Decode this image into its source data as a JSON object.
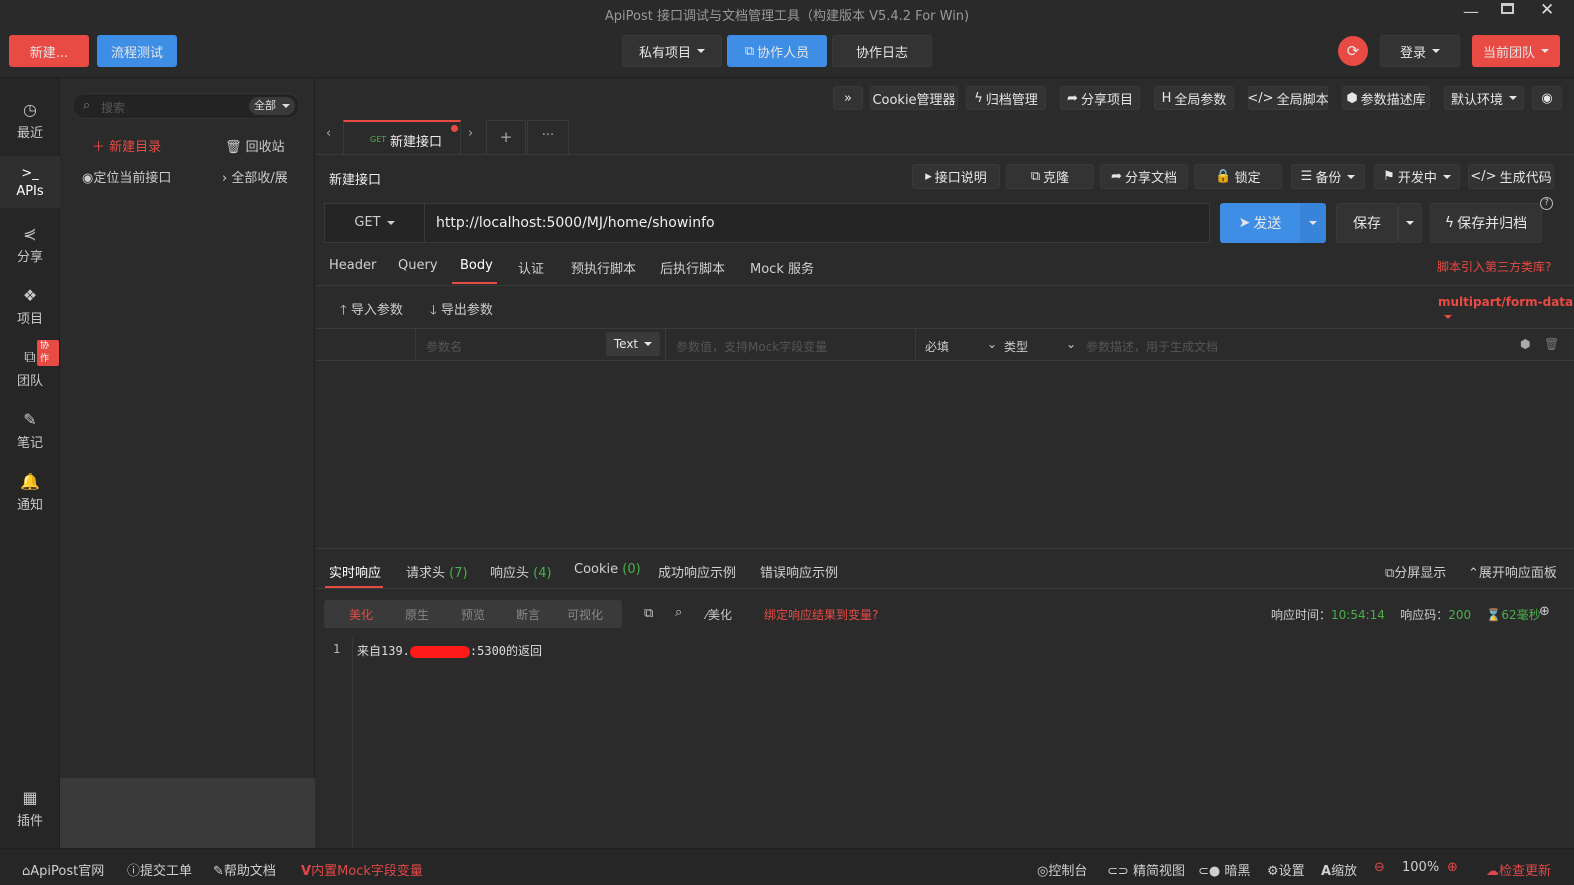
{
  "window": {
    "title": "ApiPost 接口调试与文档管理工具（构建版本 V5.4.2 For Win)",
    "controls": [
      "minimize-icon",
      "maximize-icon",
      "close-icon"
    ]
  },
  "topbar": {
    "new_label": "新建...",
    "flow_test_label": "流程测试",
    "private_project_label": "私有项目",
    "collaborators_label": "协作人员",
    "collab_log_label": "协作日志",
    "login_label": "登录",
    "current_team_label": "当前团队",
    "colors": {
      "accent_red": "#e84a44",
      "accent_blue": "#3f8ee6"
    }
  },
  "leftnav": {
    "items": [
      {
        "label": "最近",
        "icon": "clock-icon"
      },
      {
        "label": "APIs",
        "icon": "terminal-icon"
      },
      {
        "label": "分享",
        "icon": "share-icon"
      },
      {
        "label": "项目",
        "icon": "cubes-icon"
      },
      {
        "label": "团队",
        "icon": "sitemap-icon",
        "badge": "协作"
      },
      {
        "label": "笔记",
        "icon": "edit-icon"
      },
      {
        "label": "通知",
        "icon": "bell-icon"
      },
      {
        "label": "插件",
        "icon": "grid-icon"
      }
    ]
  },
  "tree": {
    "search_placeholder": "搜索",
    "filter_label": "全部",
    "new_dir_label": "新建目录",
    "recycle_label": "回收站",
    "locate_label": "定位当前接口",
    "collapse_label": "全部收/展"
  },
  "toolbar": {
    "cookie_label": "Cookie管理器",
    "archive_label": "归档管理",
    "share_project_label": "分享项目",
    "global_params_label": "全局参数",
    "global_script_label": "全局脚本",
    "param_desc_label": "参数描述库",
    "env_label": "默认环境"
  },
  "tabs": {
    "active": {
      "method": "GET",
      "name": "新建接口"
    }
  },
  "request": {
    "name": "新建接口",
    "actions": {
      "doc_label": "接口说明",
      "clone_label": "克隆",
      "share_doc_label": "分享文档",
      "lock_label": "锁定",
      "backup_label": "备份",
      "status_label": "开发中",
      "gen_code_label": "生成代码"
    },
    "method": "GET",
    "url": "http://localhost:5000/MJ/home/showinfo",
    "send_label": "发送",
    "save_label": "保存",
    "save_archive_label": "保存并归档",
    "subtabs": [
      "Header",
      "Query",
      "Body",
      "认证",
      "预执行脚本",
      "后执行脚本",
      "Mock 服务"
    ],
    "active_subtab": "Body",
    "third_party_label": "脚本引入第三方类库?",
    "import_label": "导入参数",
    "export_label": "导出参数",
    "body_type": "multipart/form-data",
    "param_row": {
      "name_placeholder": "参数名",
      "type_label": "Text",
      "value_placeholder": "参数值，支持Mock字段变量",
      "required_label": "必填",
      "kind_label": "类型",
      "desc_placeholder": "参数描述，用于生成文档"
    }
  },
  "response": {
    "tabs": [
      {
        "label": "实时响应",
        "count": ""
      },
      {
        "label": "请求头",
        "count": "(7)"
      },
      {
        "label": "响应头",
        "count": "(4)"
      },
      {
        "label": "Cookie",
        "count": "(0)"
      },
      {
        "label": "成功响应示例",
        "count": ""
      },
      {
        "label": "错误响应示例",
        "count": ""
      }
    ],
    "split_label": "分屏显示",
    "expand_label": "展开响应面板",
    "views": [
      "美化",
      "原生",
      "预览",
      "断言",
      "可视化"
    ],
    "beautify_label": "美化",
    "bind_label": "绑定响应结果到变量?",
    "time_label": "响应时间：",
    "time_value": "10:54:14",
    "code_label": "响应码：",
    "code_value": "200",
    "duration_value": "62毫秒",
    "lines": [
      {
        "num": "1",
        "prefix": "来自139.",
        "suffix": ":5300的返回"
      }
    ]
  },
  "status": {
    "site_label": "ApiPost官网",
    "ticket_label": "提交工单",
    "help_label": "帮助文档",
    "mock_label": "内置Mock字段变量",
    "console_label": "控制台",
    "compact_label": "精简视图",
    "dark_label": "暗黑",
    "settings_label": "设置",
    "zoom_label": "缩放",
    "zoom_value": "100%",
    "update_label": "检查更新"
  }
}
